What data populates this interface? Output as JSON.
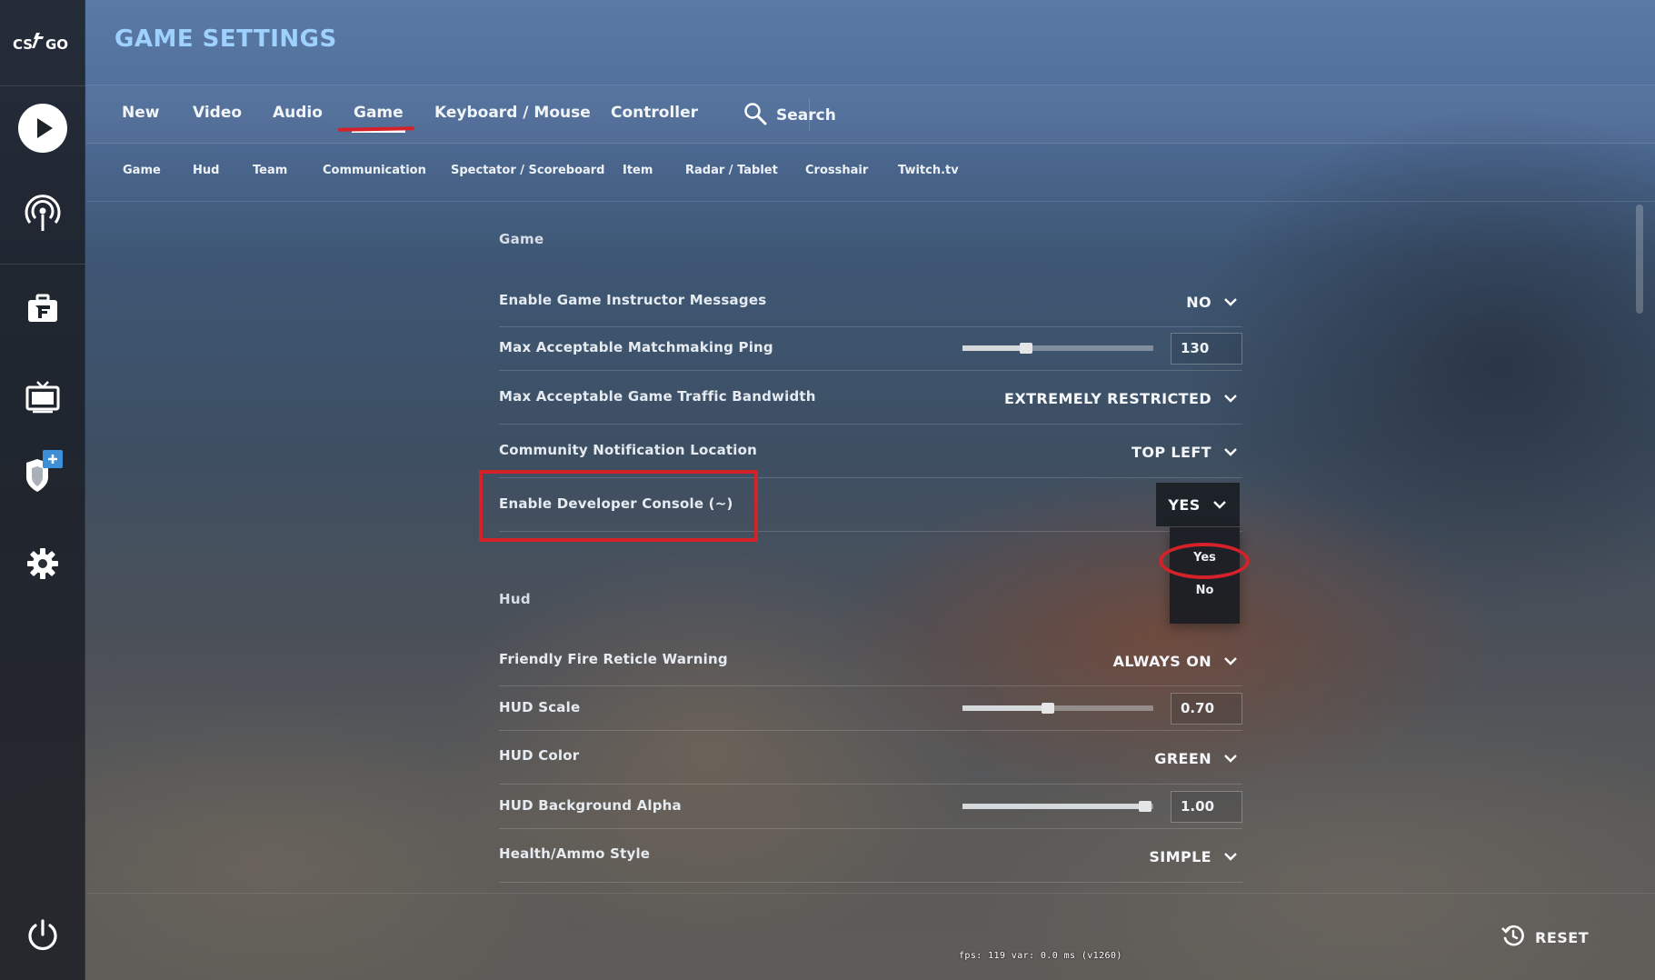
{
  "app": {
    "logo_text": "CS:GO"
  },
  "header": {
    "title": "GAME SETTINGS"
  },
  "sidebar": {
    "icons": [
      "play-icon",
      "broadcast-icon",
      "briefcase-icon",
      "tv-icon",
      "shield-plus-icon",
      "gear-icon",
      "power-icon"
    ]
  },
  "main_tabs": [
    {
      "label": "New"
    },
    {
      "label": "Video"
    },
    {
      "label": "Audio"
    },
    {
      "label": "Game",
      "active": true
    },
    {
      "label": "Keyboard / Mouse"
    },
    {
      "label": "Controller"
    }
  ],
  "search": {
    "label": "Search"
  },
  "sub_tabs": [
    {
      "label": "Game"
    },
    {
      "label": "Hud"
    },
    {
      "label": "Team"
    },
    {
      "label": "Communication"
    },
    {
      "label": "Spectator / Scoreboard"
    },
    {
      "label": "Item"
    },
    {
      "label": "Radar / Tablet"
    },
    {
      "label": "Crosshair"
    },
    {
      "label": "Twitch.tv"
    }
  ],
  "sections": {
    "game": {
      "title": "Game",
      "rows": [
        {
          "label": "Enable Game Instructor Messages",
          "type": "dropdown",
          "value": "NO"
        },
        {
          "label": "Max Acceptable Matchmaking Ping",
          "type": "slider",
          "value": "130",
          "fraction": 0.33
        },
        {
          "label": "Max Acceptable Game Traffic Bandwidth",
          "type": "dropdown",
          "value": "EXTREMELY RESTRICTED"
        },
        {
          "label": "Community Notification Location",
          "type": "dropdown",
          "value": "TOP LEFT"
        },
        {
          "label": "Enable Developer Console (~)",
          "type": "dropdown",
          "value": "YES",
          "open": true,
          "options": [
            "Yes",
            "No"
          ]
        }
      ]
    },
    "hud": {
      "title": "Hud",
      "rows": [
        {
          "label": "Friendly Fire Reticle Warning",
          "type": "dropdown",
          "value": "ALWAYS ON"
        },
        {
          "label": "HUD Scale",
          "type": "slider",
          "value": "0.70",
          "fraction": 0.45
        },
        {
          "label": "HUD Color",
          "type": "dropdown",
          "value": "GREEN"
        },
        {
          "label": "HUD Background Alpha",
          "type": "slider",
          "value": "1.00",
          "fraction": 0.96
        },
        {
          "label": "Health/Ammo Style",
          "type": "dropdown",
          "value": "SIMPLE"
        }
      ]
    }
  },
  "footer": {
    "reset_label": "RESET",
    "fps_text": "fps:   119  var:  0.0 ms  (v1260)"
  },
  "colors": {
    "title": "#9fd1ff",
    "highlight": "#d4212a"
  }
}
